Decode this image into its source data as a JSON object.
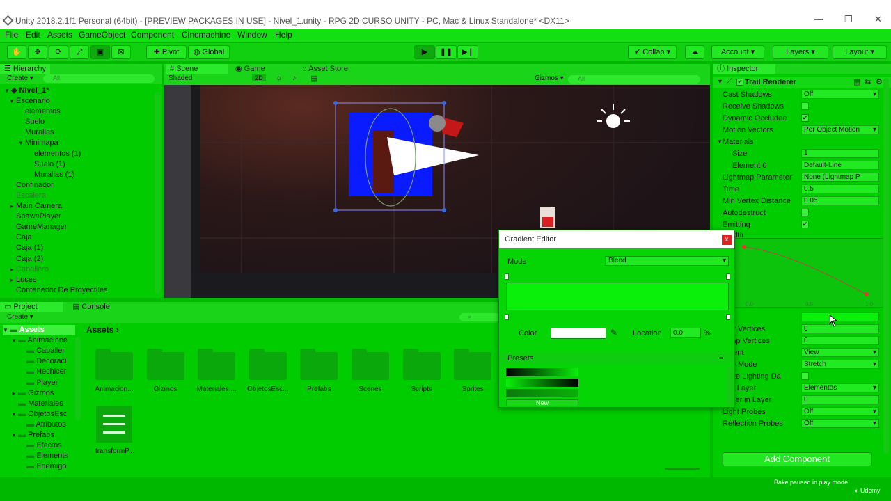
{
  "window": {
    "title": "Unity 2018.2.1f1 Personal (64bit) - [PREVIEW PACKAGES IN USE] - Nivel_1.unity - RPG 2D CURSO UNITY - PC, Mac & Linux Standalone* <DX11>",
    "minimize": "—",
    "restore": "❐",
    "close": "✕"
  },
  "menu": [
    "File",
    "Edit",
    "Assets",
    "GameObject",
    "Component",
    "Cinemachine",
    "Window",
    "Help"
  ],
  "toolbar": {
    "pivot": "Pivot",
    "global": "Global",
    "collab": "Collab",
    "account": "Account",
    "layers": "Layers",
    "layout": "Layout"
  },
  "hierarchy": {
    "tab": "Hierarchy",
    "create": "Create",
    "search_placeholder": "All",
    "scene": "Nivel_1*",
    "items": [
      {
        "label": "Escenario",
        "indent": 1,
        "arrow": "▼"
      },
      {
        "label": "elementos",
        "indent": 2,
        "arrow": ""
      },
      {
        "label": "Suelo",
        "indent": 2,
        "arrow": ""
      },
      {
        "label": "Murallas",
        "indent": 2,
        "arrow": ""
      },
      {
        "label": "Minimapa",
        "indent": 2,
        "arrow": "▼"
      },
      {
        "label": "elementos (1)",
        "indent": 3,
        "arrow": ""
      },
      {
        "label": "Suelo (1)",
        "indent": 3,
        "arrow": ""
      },
      {
        "label": "Murallas (1)",
        "indent": 3,
        "arrow": ""
      },
      {
        "label": "Confinador",
        "indent": 1,
        "arrow": ""
      },
      {
        "label": "Escalera",
        "indent": 1,
        "arrow": "",
        "dim": true
      },
      {
        "label": "Main Camera",
        "indent": 1,
        "arrow": "►"
      },
      {
        "label": "SpawnPlayer",
        "indent": 1,
        "arrow": ""
      },
      {
        "label": "GameManager",
        "indent": 1,
        "arrow": ""
      },
      {
        "label": "Caja",
        "indent": 1,
        "arrow": ""
      },
      {
        "label": "Caja (1)",
        "indent": 1,
        "arrow": ""
      },
      {
        "label": "Caja (2)",
        "indent": 1,
        "arrow": ""
      },
      {
        "label": "Caballero",
        "indent": 1,
        "arrow": "►",
        "dim": true
      },
      {
        "label": "Luces",
        "indent": 1,
        "arrow": "►"
      },
      {
        "label": "Contenedor De Proyectiles",
        "indent": 1,
        "arrow": ""
      }
    ]
  },
  "scene": {
    "tabs": [
      "Scene",
      "Game",
      "Asset Store"
    ],
    "shading": "Shaded",
    "mode2d": "2D",
    "gizmos": "Gizmos",
    "search_placeholder": "All"
  },
  "inspector": {
    "tab": "Inspector",
    "component": "Trail Renderer",
    "rows": [
      {
        "label": "Cast Shadows",
        "type": "dropdown",
        "value": "Off"
      },
      {
        "label": "Receive Shadows",
        "type": "check",
        "value": ""
      },
      {
        "label": "Dynamic Occludee",
        "type": "check",
        "value": "✔"
      },
      {
        "label": "Motion Vectors",
        "type": "dropdown",
        "value": "Per Object Motion"
      },
      {
        "label": "Materials",
        "type": "header",
        "value": ""
      },
      {
        "label": "Size",
        "type": "field",
        "value": "1",
        "sub": true
      },
      {
        "label": "Element 0",
        "type": "field",
        "value": "Default-Line",
        "sub": true
      },
      {
        "label": "Lightmap Parameter",
        "type": "field",
        "value": "None (Lightmap P"
      },
      {
        "label": "Time",
        "type": "field",
        "value": "0.5"
      },
      {
        "label": "Min Vertex Distance",
        "type": "field",
        "value": "0.05"
      },
      {
        "label": "Autodestruct",
        "type": "check",
        "value": ""
      },
      {
        "label": "Emitting",
        "type": "check",
        "value": "✔"
      }
    ],
    "width_label": "dth",
    "curve_ticks": [
      "0.0",
      "0.5",
      "1.0"
    ],
    "lower_rows": [
      {
        "label": "lor",
        "type": "color",
        "value": ""
      },
      {
        "label": "mer Vertices",
        "type": "field",
        "value": "0"
      },
      {
        "label": "l Cap Vertices",
        "type": "field",
        "value": "0"
      },
      {
        "label": "nment",
        "type": "dropdown",
        "value": "View"
      },
      {
        "label": "ture Mode",
        "type": "dropdown",
        "value": "Stretch"
      },
      {
        "label": "erate Lighting Da",
        "type": "check",
        "value": ""
      },
      {
        "label": "ting Layer",
        "type": "dropdown",
        "value": "Elementos"
      },
      {
        "label": "Order in Layer",
        "type": "field",
        "value": "0"
      },
      {
        "label": "Light Probes",
        "type": "dropdown",
        "value": "Off"
      },
      {
        "label": "Reflection Probes",
        "type": "dropdown",
        "value": "Off"
      }
    ],
    "add_component": "Add Component"
  },
  "project": {
    "tabs": [
      "Project",
      "Console"
    ],
    "create": "Create",
    "breadcrumb": "Assets",
    "tree": [
      {
        "label": "Assets",
        "indent": 0,
        "arrow": "▼",
        "selected": true
      },
      {
        "label": "Animacione",
        "indent": 1,
        "arrow": "▼"
      },
      {
        "label": "Caballer",
        "indent": 2,
        "arrow": ""
      },
      {
        "label": "Decoraci",
        "indent": 2,
        "arrow": ""
      },
      {
        "label": "Hechicer",
        "indent": 2,
        "arrow": ""
      },
      {
        "label": "Player",
        "indent": 2,
        "arrow": ""
      },
      {
        "label": "Gizmos",
        "indent": 1,
        "arrow": "►"
      },
      {
        "label": "Materiales",
        "indent": 1,
        "arrow": ""
      },
      {
        "label": "ObjetosEsc",
        "indent": 1,
        "arrow": "▼"
      },
      {
        "label": "Atributos",
        "indent": 2,
        "arrow": ""
      },
      {
        "label": "Prefabs",
        "indent": 1,
        "arrow": "▼"
      },
      {
        "label": "Efectos",
        "indent": 2,
        "arrow": ""
      },
      {
        "label": "Elements",
        "indent": 2,
        "arrow": ""
      },
      {
        "label": "Enemigo",
        "indent": 2,
        "arrow": ""
      }
    ],
    "folders": [
      "Animacion...",
      "Gizmos",
      "Materiales ...",
      "ObjetosEsc...",
      "Prefabs",
      "Scenes",
      "Scripts",
      "Sprites"
    ],
    "asset_file": "transformP..."
  },
  "gradient_editor": {
    "title": "Gradient Editor",
    "mode_label": "Mode",
    "mode_value": "Blend",
    "color_label": "Color",
    "location_label": "Location",
    "location_value": "0.0",
    "percent": "%",
    "presets_label": "Presets",
    "new_label": "New",
    "close": "x"
  },
  "status": {
    "bake": "Bake paused in play mode",
    "udemy": "Udemy"
  },
  "colors": {
    "bg_green": "#00cc00",
    "gradient_green": "#0af00a",
    "scene_dark": "#1e1418",
    "close_red": "#d22"
  }
}
